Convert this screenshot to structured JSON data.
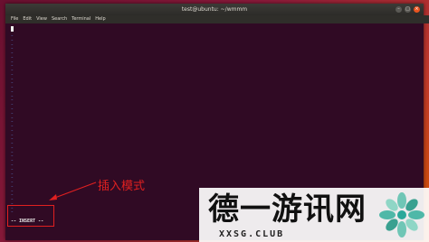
{
  "window": {
    "title": "test@ubuntu: ~/wmmm",
    "buttons": {
      "minimize": "–",
      "maximize": "□",
      "close": "×"
    }
  },
  "menu": [
    "File",
    "Edit",
    "View",
    "Search",
    "Terminal",
    "Help"
  ],
  "terminal": {
    "empty_line_marker": "~",
    "status_line": "-- INSERT --"
  },
  "annotation": {
    "label": "插入模式",
    "color": "#e02020"
  },
  "watermark": {
    "text": "德一游讯网",
    "domain": "XXSG.CLUB"
  },
  "colors": {
    "terminal_bg": "#300a24",
    "tilde": "#5a78c8",
    "close_button": "#e95420"
  }
}
